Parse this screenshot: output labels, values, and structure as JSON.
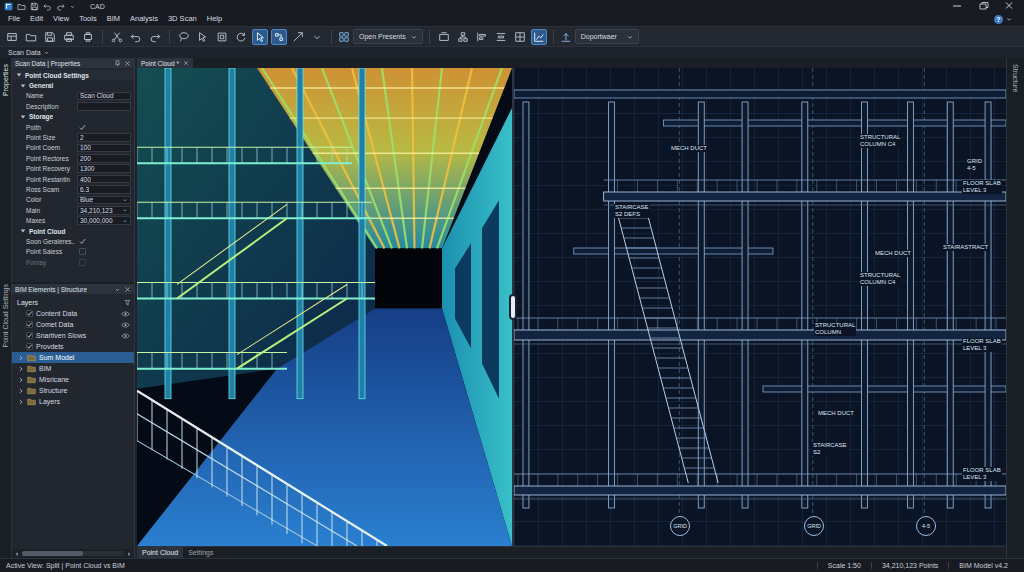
{
  "window": {
    "title": "CAD",
    "help": "?"
  },
  "menu": [
    "File",
    "Edit",
    "View",
    "Tools",
    "BIM",
    "Analysis",
    "3D Scan",
    "Help"
  ],
  "toolbar": {
    "sections": [
      {
        "kind": "buttons",
        "buttons": [
          {
            "selected": false
          },
          {
            "selected": false
          },
          {
            "selected": false
          },
          {
            "selected": false
          },
          {
            "selected": false
          }
        ]
      },
      {
        "kind": "buttons",
        "buttons": [
          {
            "selected": false
          },
          {
            "selected": false
          },
          {
            "selected": false
          }
        ]
      },
      {
        "kind": "buttons",
        "buttons": [
          {
            "selected": false
          },
          {
            "selected": false
          },
          {
            "selected": false
          },
          {
            "selected": false
          },
          {
            "selected": true
          },
          {
            "selected": true
          },
          {
            "selected": false
          },
          {
            "selected": false
          }
        ]
      },
      {
        "kind": "dropdown",
        "value": "Open Presents"
      },
      {
        "kind": "buttons",
        "buttons": [
          {
            "selected": false
          },
          {
            "selected": false
          },
          {
            "selected": false
          },
          {
            "selected": false
          },
          {
            "selected": false
          },
          {
            "selected": true
          }
        ]
      },
      {
        "kind": "dropdown",
        "value": "Doportwaer"
      }
    ]
  },
  "subbar": {
    "label": "Scan Data"
  },
  "left_strip": {
    "tabs": [
      {
        "label": "Properties",
        "selected": true
      },
      {
        "label": "Point Cloud Settings",
        "selected": false
      }
    ]
  },
  "properties": {
    "title": "Scan Data | Properties",
    "heading": "Point Cloud Settings",
    "expanded": true,
    "sections": [
      {
        "title": "General",
        "expanded": true,
        "rows": [
          {
            "label": "Name",
            "kind": "text",
            "value": "Scan Cloud",
            "disabled": false
          },
          {
            "label": "Description",
            "kind": "text",
            "value": "",
            "disabled": false
          }
        ]
      },
      {
        "title": "Storage",
        "expanded": true,
        "rows": [
          {
            "label": "Poith",
            "kind": "check",
            "checked": true,
            "disabled": false
          },
          {
            "label": "Point Size",
            "kind": "text",
            "value": "2",
            "disabled": false
          },
          {
            "label": "Point Coem",
            "kind": "text",
            "value": "100",
            "disabled": false
          },
          {
            "label": "Point Rectores",
            "kind": "text",
            "value": "200",
            "disabled": false
          },
          {
            "label": "Point Recovery",
            "kind": "text",
            "value": "1300",
            "disabled": false
          },
          {
            "label": "Point Restantin",
            "kind": "text",
            "value": "400",
            "disabled": false
          },
          {
            "label": "Ross Scam",
            "kind": "text",
            "value": "6.3",
            "disabled": false
          },
          {
            "label": "Color",
            "kind": "select",
            "value": "Blue",
            "disabled": false
          },
          {
            "label": "Main",
            "kind": "select",
            "value": "34,210,123",
            "disabled": false
          },
          {
            "label": "Maxes",
            "kind": "select",
            "value": "30,000,000",
            "disabled": false
          }
        ]
      },
      {
        "title": "Point Cloud",
        "expanded": true,
        "rows": [
          {
            "label": "Soon Geraleres..",
            "kind": "check",
            "checked": true,
            "disabled": false
          },
          {
            "label": "Point Saiess",
            "kind": "check",
            "checked": false,
            "disabled": false
          },
          {
            "label": "Fonray",
            "kind": "check",
            "checked": false,
            "disabled": true
          }
        ]
      }
    ]
  },
  "structure": {
    "title": "BIM Elements | Structure",
    "layers_title": "Layers",
    "items": [
      {
        "label": "Content Data",
        "kind": "layer",
        "checked": true,
        "visible": true,
        "selected": false
      },
      {
        "label": "Comet Data",
        "kind": "layer",
        "checked": true,
        "visible": true,
        "selected": false
      },
      {
        "label": "Snartiven Slows",
        "kind": "layer",
        "checked": true,
        "visible": true,
        "selected": false
      },
      {
        "label": "Provdets",
        "kind": "layer",
        "checked": true,
        "visible": false,
        "selected": false
      },
      {
        "label": "Sum Model",
        "kind": "folder",
        "expanded": false,
        "selected": true
      },
      {
        "label": "BIM",
        "kind": "folder",
        "expanded": false,
        "selected": false
      },
      {
        "label": "Misricane",
        "kind": "folder",
        "expanded": false,
        "selected": false
      },
      {
        "label": "Structure",
        "kind": "folder",
        "expanded": false,
        "selected": false
      },
      {
        "label": "Layers",
        "kind": "folder",
        "expanded": false,
        "selected": false
      }
    ]
  },
  "viewport": {
    "tab": {
      "label": "Point Cloud *",
      "selected": true
    },
    "annotations": [
      {
        "lines": [
          "MECH DUCT"
        ]
      },
      {
        "lines": [
          "STRUCTURAL",
          "COLUMN C4"
        ]
      },
      {
        "lines": [
          "GRID",
          "4-5"
        ]
      },
      {
        "lines": [
          "FLOOR SLAB",
          "LEVEL 3"
        ]
      },
      {
        "lines": [
          "STAIRCASE",
          "S2 DEFS"
        ]
      },
      {
        "lines": [
          "STAIRASTRACT"
        ]
      },
      {
        "lines": [
          "MECH DUCT"
        ]
      },
      {
        "lines": [
          "STRUCTURAL",
          "COLUMN C4"
        ]
      },
      {
        "lines": [
          "STRUCTURAL",
          "COLUMN"
        ]
      },
      {
        "lines": [
          "FLOOR SLAB",
          "LEVEL 3"
        ]
      },
      {
        "lines": [
          "MECH DUCT"
        ]
      },
      {
        "lines": [
          "STAIRCASE",
          "S2"
        ]
      },
      {
        "lines": [
          "FLOOR SLAB",
          "LEVEL 3"
        ]
      }
    ],
    "grid_bubbles": [
      "GRID",
      "GRID",
      "4-5"
    ],
    "bottom_tabs": [
      {
        "label": "Point Cloud",
        "selected": true
      },
      {
        "label": "Settings",
        "selected": false
      }
    ]
  },
  "right_strip": {
    "tabs": [
      {
        "label": "Structure",
        "selected": false
      }
    ]
  },
  "status_bar": {
    "left": "Active View: Split | Point Cloud vs BIM",
    "items": [
      "Scale 1:50",
      "34,210,123 Points",
      "BIM Model v4.2"
    ]
  }
}
